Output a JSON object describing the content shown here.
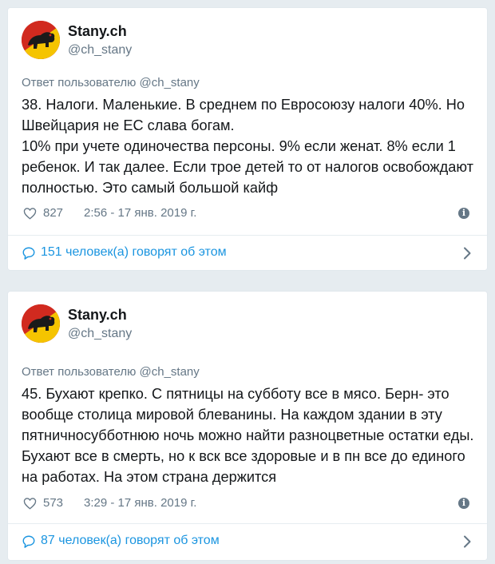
{
  "tweets": [
    {
      "name": "Stany.ch",
      "handle": "@ch_stany",
      "reply_to": "Ответ пользователю @ch_stany",
      "text": "38. Налоги. Маленькие. В среднем по Евросоюзу налоги 40%. Но Швейцария не ЕС слава богам.\n10% при учете одиночества персоны. 9% если женат. 8% если 1 ребенок. И так далее. Если трое детей то от налогов освобождают полностью. Это самый большой кайф",
      "likes": "827",
      "time": "2:56 - 17 янв. 2019 г.",
      "conversation": "151 человек(а) говорят об этом"
    },
    {
      "name": "Stany.ch",
      "handle": "@ch_stany",
      "reply_to": "Ответ пользователю @ch_stany",
      "text": "45. Бухают крепко. С пятницы на субботу все в мясо. Берн- это вообще столица мировой блеванины. На каждом здании в эту пятничносубботнюю ночь можно найти разноцветные остатки еды. Бухают все в смерть, но к вск все здоровые и в пн все до единого на работах. На этом страна держится",
      "likes": "573",
      "time": "3:29 - 17 янв. 2019 г.",
      "conversation": "87 человек(а) говорят об этом"
    }
  ],
  "icons": {
    "like": "heart-outline-icon",
    "info": "info-icon",
    "reply": "speech-bubble-icon",
    "open": "chevron-right-icon"
  },
  "colors": {
    "background": "#e6ecf0",
    "text": "#14171a",
    "secondary": "#657786",
    "link": "#1b95e0",
    "avatar_red": "#d12a1f",
    "avatar_yellow": "#f5c400"
  }
}
